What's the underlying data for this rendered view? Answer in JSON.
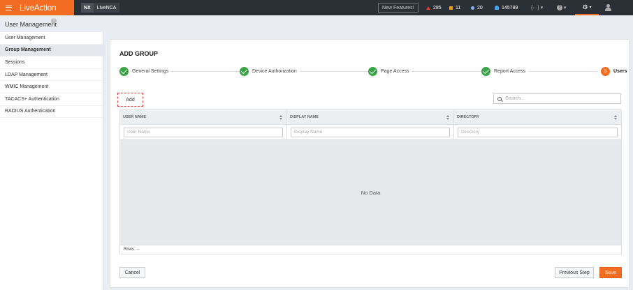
{
  "topbar": {
    "brand": "LiveAction",
    "badge": "NX",
    "product": "LiveNCA",
    "new_features": "New Features!",
    "alerts": {
      "critical": "285",
      "warning": "11",
      "info": "20",
      "notifications": "145789"
    },
    "dots_label": "{···}",
    "help_label": "?",
    "accent_color": "#f26d21"
  },
  "page": {
    "title": "User Management",
    "help": "?"
  },
  "sidebar": {
    "items": [
      {
        "label": "User Management"
      },
      {
        "label": "Group Management"
      },
      {
        "label": "Sessions"
      },
      {
        "label": "LDAP Management"
      },
      {
        "label": "WMIC Management"
      },
      {
        "label": "TACACS+ Authentication"
      },
      {
        "label": "RADIUS Authentication"
      }
    ],
    "active_index": 1
  },
  "card": {
    "title": "ADD GROUP",
    "steps": [
      {
        "label": "General Settings",
        "status": "done"
      },
      {
        "label": "Device Authorization",
        "status": "done"
      },
      {
        "label": "Page Access",
        "status": "done"
      },
      {
        "label": "Report Access",
        "status": "done"
      },
      {
        "label": "Users",
        "status": "current",
        "number": "5"
      }
    ],
    "add_label": "Add",
    "search_placeholder": "Search...",
    "columns": [
      {
        "header": "USER NAME",
        "filter_placeholder": "User Name"
      },
      {
        "header": "DISPLAY NAME",
        "filter_placeholder": "Display Name"
      },
      {
        "header": "DIRECTORY",
        "filter_placeholder": "Directory"
      }
    ],
    "empty_text": "No Data",
    "rows_label": "Rows: --",
    "cancel_label": "Cancel",
    "previous_label": "Previous Step",
    "save_label": "Save"
  }
}
